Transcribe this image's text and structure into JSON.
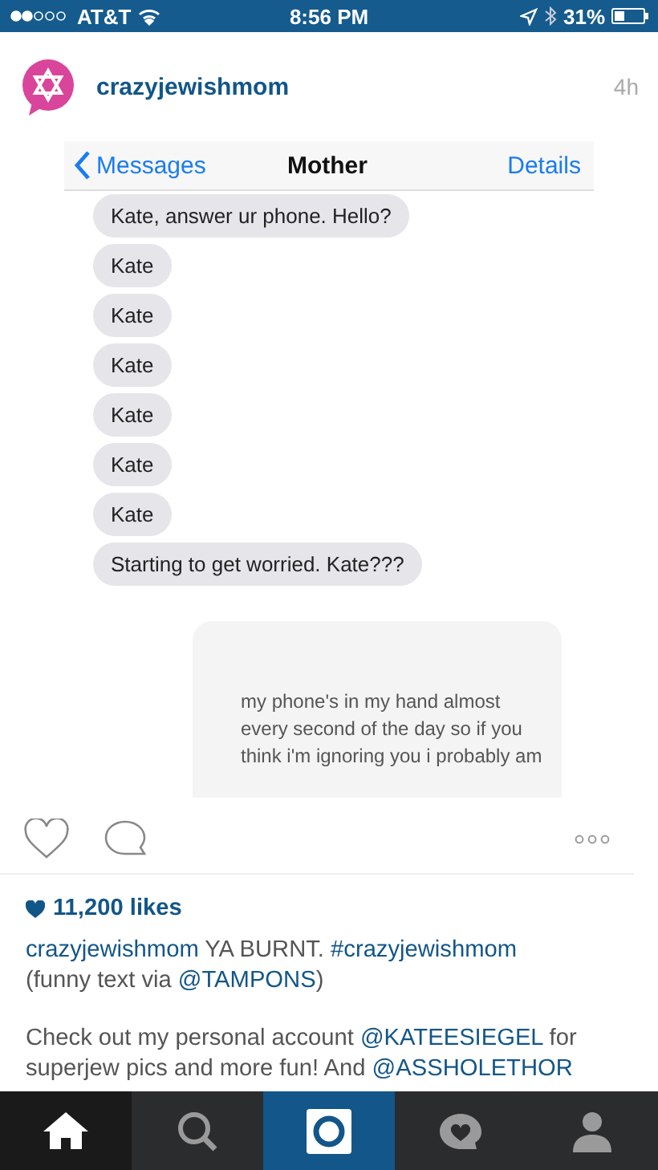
{
  "status_bar": {
    "carrier": "AT&T",
    "time": "8:56 PM",
    "battery": "31%"
  },
  "post": {
    "username": "crazyjewishmom",
    "age": "4h"
  },
  "screenshot": {
    "back": "Messages",
    "title": "Mother",
    "details": "Details",
    "messages": [
      {
        "kind": "received",
        "text": "Kate, answer ur phone. Hello?"
      },
      {
        "kind": "received",
        "text": "Kate"
      },
      {
        "kind": "received",
        "text": "Kate"
      },
      {
        "kind": "received",
        "text": "Kate"
      },
      {
        "kind": "received",
        "text": "Kate"
      },
      {
        "kind": "received",
        "text": "Kate"
      },
      {
        "kind": "received",
        "text": "Kate"
      },
      {
        "kind": "received",
        "text": "Starting to get worried. Kate???"
      },
      {
        "kind": "sent",
        "text": "my phone's in my hand almost every second of the day so if you think i'm ignoring you i probably am"
      }
    ]
  },
  "likes": "11,200 likes",
  "caption": [
    [
      {
        "kind": "link",
        "text": "crazyjewishmom"
      },
      {
        "kind": "plain",
        "text": " YA BURNT. "
      },
      {
        "kind": "link",
        "text": "#crazyjewishmom"
      },
      {
        "kind": "break"
      },
      {
        "kind": "plain",
        "text": "(funny text via "
      },
      {
        "kind": "link",
        "text": "@TAMPONS"
      },
      {
        "kind": "plain",
        "text": ")"
      }
    ],
    [
      {
        "kind": "plain",
        "text": "Check out my personal account "
      },
      {
        "kind": "link",
        "text": "@KATEESIEGEL"
      },
      {
        "kind": "plain",
        "text": " for superjew pics and more fun! And "
      },
      {
        "kind": "link",
        "text": "@ASSHOLETHOR"
      }
    ]
  ],
  "tabs": [
    {
      "kind": "home",
      "selected": true
    },
    {
      "kind": "search",
      "selected": false
    },
    {
      "kind": "camera",
      "selected": false
    },
    {
      "kind": "activity",
      "selected": false
    },
    {
      "kind": "profile",
      "selected": false
    }
  ]
}
